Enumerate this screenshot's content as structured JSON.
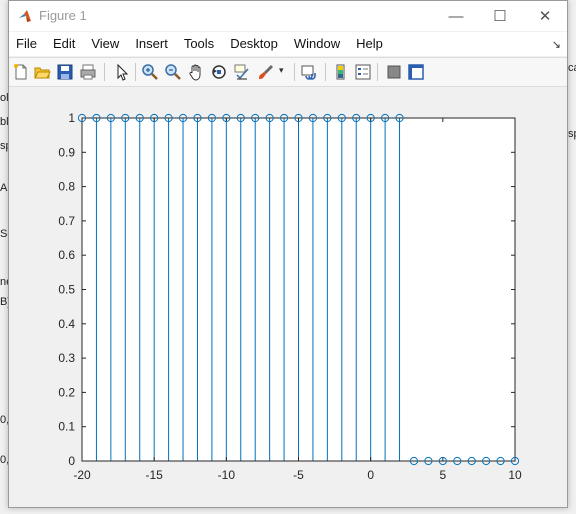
{
  "background_left": [
    "ol",
    "bl",
    "sp",
    "AB",
    "Se",
    "ne",
    "B]",
    "0,",
    "0,"
  ],
  "background_right": [
    "ca",
    "sp"
  ],
  "window": {
    "title": "Figure 1",
    "controls": {
      "minimize": "—",
      "maximize": "☐",
      "close": "✕"
    }
  },
  "menu": [
    "File",
    "Edit",
    "View",
    "Insert",
    "Tools",
    "Desktop",
    "Window",
    "Help"
  ],
  "toolbar_icons": [
    "new-figure-icon",
    "open-file-icon",
    "save-icon",
    "print-icon",
    "select-arrow-icon",
    "zoom-in-icon",
    "zoom-out-icon",
    "pan-icon",
    "rotate-3d-icon",
    "data-cursor-icon",
    "brush-icon",
    "link-plot-icon",
    "colorbar-icon",
    "legend-icon",
    "hide-plot-tools-icon",
    "show-plot-tools-icon"
  ],
  "colors": {
    "stem": "#0072bd",
    "axes": "#262626"
  },
  "chart_data": {
    "type": "stem",
    "title": "",
    "xlabel": "",
    "ylabel": "",
    "xlim": [
      -20,
      10
    ],
    "ylim": [
      0,
      1
    ],
    "xticks": [
      -20,
      -15,
      -10,
      -5,
      0,
      5,
      10
    ],
    "yticks": [
      0,
      0.1,
      0.2,
      0.3,
      0.4,
      0.5,
      0.6,
      0.7,
      0.8,
      0.9,
      1
    ],
    "xtick_labels": [
      "-20",
      "-15",
      "-10",
      "-5",
      "0",
      "5",
      "10"
    ],
    "ytick_labels": [
      "0",
      "0.1",
      "0.2",
      "0.3",
      "0.4",
      "0.5",
      "0.6",
      "0.7",
      "0.8",
      "0.9",
      "1"
    ],
    "x": [
      -20,
      -19,
      -18,
      -17,
      -16,
      -15,
      -14,
      -13,
      -12,
      -11,
      -10,
      -9,
      -8,
      -7,
      -6,
      -5,
      -4,
      -3,
      -2,
      -1,
      0,
      1,
      2,
      3,
      4,
      5,
      6,
      7,
      8,
      9,
      10
    ],
    "y": [
      1,
      1,
      1,
      1,
      1,
      1,
      1,
      1,
      1,
      1,
      1,
      1,
      1,
      1,
      1,
      1,
      1,
      1,
      1,
      1,
      1,
      1,
      1,
      0,
      0,
      0,
      0,
      0,
      0,
      0,
      0
    ]
  }
}
